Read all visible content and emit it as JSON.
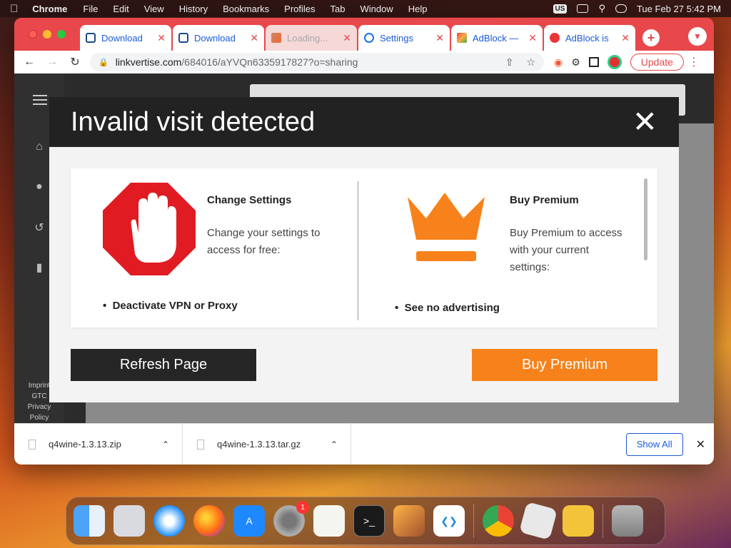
{
  "menubar": {
    "app": "Chrome",
    "items": [
      "File",
      "Edit",
      "View",
      "History",
      "Bookmarks",
      "Profiles",
      "Tab",
      "Window",
      "Help"
    ],
    "input_source": "US",
    "clock": "Tue Feb 27  5:42 PM"
  },
  "tabs": [
    {
      "label": "Download",
      "icon": "square-favicon"
    },
    {
      "label": "Download",
      "icon": "square-favicon"
    },
    {
      "label": "Loading...",
      "icon": "mountain-favicon"
    },
    {
      "label": "Settings",
      "icon": "gear-favicon"
    },
    {
      "label": "AdBlock —",
      "icon": "rainbow-favicon"
    },
    {
      "label": "AdBlock is",
      "icon": "adblock-favicon"
    }
  ],
  "address": {
    "host": "linkvertise.com",
    "path": "/684016/aYVQn6335917827?o=sharing"
  },
  "toolbar": {
    "update_label": "Update"
  },
  "sidebar_footer": [
    "Imprint",
    "GTC",
    "Privacy",
    "Policy"
  ],
  "modal": {
    "title": "Invalid visit detected",
    "left": {
      "heading": "Change Settings",
      "text": "Change your settings to access for free:",
      "bullet": "Deactivate VPN or Proxy"
    },
    "right": {
      "heading": "Buy Premium",
      "text": "Buy Premium to access with your current settings:",
      "bullet": "See no advertising"
    },
    "refresh_label": "Refresh Page",
    "premium_label": "Buy Premium",
    "colors": {
      "accent": "#f7821b",
      "stop": "#e01b22",
      "dark": "#222222"
    }
  },
  "downloads": {
    "items": [
      "q4wine-1.3.13.zip",
      "q4wine-1.3.13.tar.gz"
    ],
    "show_all": "Show All"
  },
  "dock": {
    "apps": [
      "finder",
      "launchpad",
      "safari",
      "firefox",
      "app-store",
      "system-preferences",
      "textedit",
      "terminal",
      "garageband",
      "vscode",
      "chrome",
      "roblox",
      "game",
      "trash"
    ],
    "system_prefs_badge": "1"
  }
}
